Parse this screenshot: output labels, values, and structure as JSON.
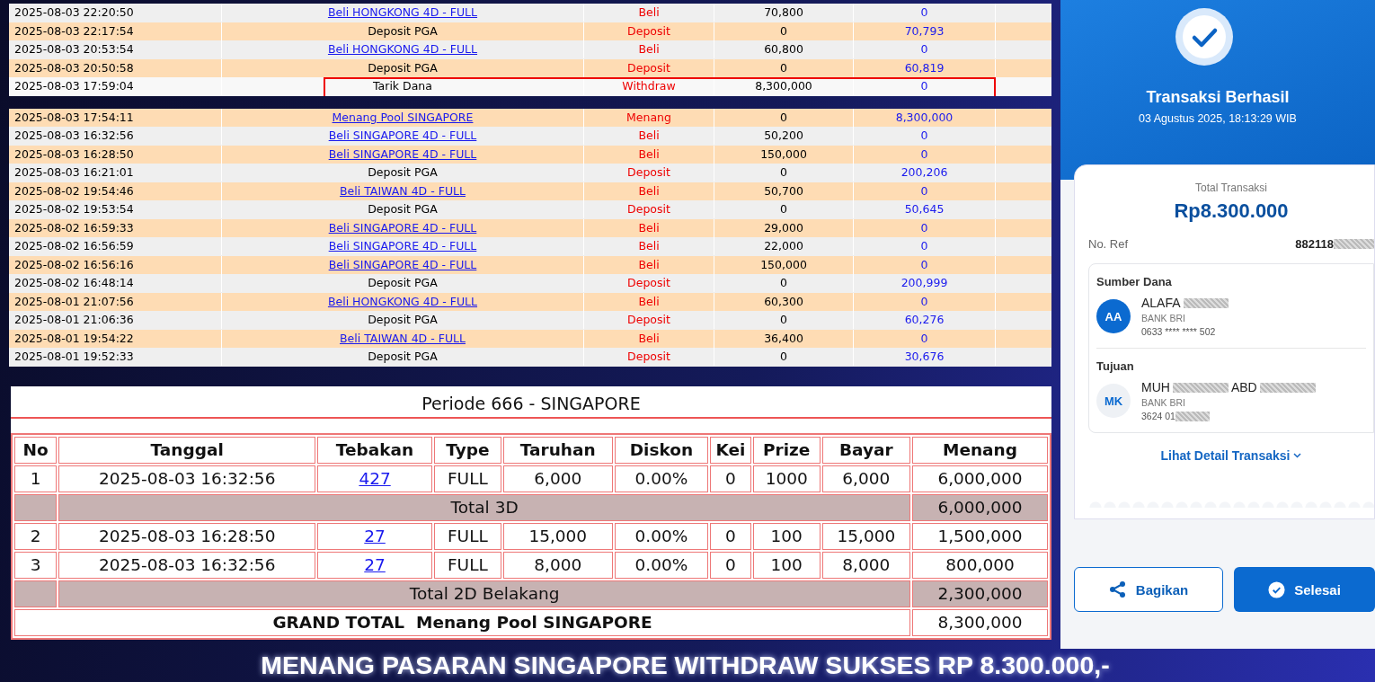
{
  "transactions_top": {
    "rows": [
      {
        "date": "2025-08-03 22:20:50",
        "description": "Beli HONGKONG 4D - FULL",
        "kind": "link",
        "type": "Beli",
        "amount": "70,800",
        "balance": "0",
        "highlighted": false
      },
      {
        "date": "2025-08-03 22:17:54",
        "description": "Deposit PGA",
        "kind": "text",
        "type": "Deposit",
        "amount": "0",
        "balance": "70,793",
        "highlighted": false
      },
      {
        "date": "2025-08-03 20:53:54",
        "description": "Beli HONGKONG 4D - FULL",
        "kind": "link",
        "type": "Beli",
        "amount": "60,800",
        "balance": "0",
        "highlighted": false
      },
      {
        "date": "2025-08-03 20:50:58",
        "description": "Deposit PGA",
        "kind": "text",
        "type": "Deposit",
        "amount": "0",
        "balance": "60,819",
        "highlighted": false
      },
      {
        "date": "2025-08-03 17:59:04",
        "description": "Tarik Dana",
        "kind": "text",
        "type": "Withdraw",
        "amount": "8,300,000",
        "balance": "0",
        "highlighted": true
      }
    ]
  },
  "transactions": {
    "rows": [
      {
        "date": "2025-08-03 17:54:11",
        "description": "Menang Pool SINGAPORE",
        "kind": "link",
        "type": "Menang",
        "amount": "0",
        "balance": "8,300,000",
        "highlighted": false
      },
      {
        "date": "2025-08-03 16:32:56",
        "description": "Beli SINGAPORE 4D - FULL",
        "kind": "link",
        "type": "Beli",
        "amount": "50,200",
        "balance": "0",
        "highlighted": false
      },
      {
        "date": "2025-08-03 16:28:50",
        "description": "Beli SINGAPORE 4D - FULL",
        "kind": "link",
        "type": "Beli",
        "amount": "150,000",
        "balance": "0",
        "highlighted": false
      },
      {
        "date": "2025-08-03 16:21:01",
        "description": "Deposit PGA",
        "kind": "text",
        "type": "Deposit",
        "amount": "0",
        "balance": "200,206",
        "highlighted": false
      },
      {
        "date": "2025-08-02 19:54:46",
        "description": "Beli TAIWAN 4D - FULL",
        "kind": "link",
        "type": "Beli",
        "amount": "50,700",
        "balance": "0",
        "highlighted": false
      },
      {
        "date": "2025-08-02 19:53:54",
        "description": "Deposit PGA",
        "kind": "text",
        "type": "Deposit",
        "amount": "0",
        "balance": "50,645",
        "highlighted": false
      },
      {
        "date": "2025-08-02 16:59:33",
        "description": "Beli SINGAPORE 4D - FULL",
        "kind": "link",
        "type": "Beli",
        "amount": "29,000",
        "balance": "0",
        "highlighted": false
      },
      {
        "date": "2025-08-02 16:56:59",
        "description": "Beli SINGAPORE 4D - FULL",
        "kind": "link",
        "type": "Beli",
        "amount": "22,000",
        "balance": "0",
        "highlighted": false
      },
      {
        "date": "2025-08-02 16:56:16",
        "description": "Beli SINGAPORE 4D - FULL",
        "kind": "link",
        "type": "Beli",
        "amount": "150,000",
        "balance": "0",
        "highlighted": false
      },
      {
        "date": "2025-08-02 16:48:14",
        "description": "Deposit PGA",
        "kind": "text",
        "type": "Deposit",
        "amount": "0",
        "balance": "200,999",
        "highlighted": false
      },
      {
        "date": "2025-08-01 21:07:56",
        "description": "Beli HONGKONG 4D - FULL",
        "kind": "link",
        "type": "Beli",
        "amount": "60,300",
        "balance": "0",
        "highlighted": false
      },
      {
        "date": "2025-08-01 21:06:36",
        "description": "Deposit PGA",
        "kind": "text",
        "type": "Deposit",
        "amount": "0",
        "balance": "60,276",
        "highlighted": false
      },
      {
        "date": "2025-08-01 19:54:22",
        "description": "Beli TAIWAN 4D - FULL",
        "kind": "link",
        "type": "Beli",
        "amount": "36,400",
        "balance": "0",
        "highlighted": false
      },
      {
        "date": "2025-08-01 19:52:33",
        "description": "Deposit PGA",
        "kind": "text",
        "type": "Deposit",
        "amount": "0",
        "balance": "30,676",
        "highlighted": false
      }
    ]
  },
  "bet_report": {
    "title": "Periode 666 - SINGAPORE",
    "columns": [
      "No",
      "Tanggal",
      "Tebakan",
      "Type",
      "Taruhan",
      "Diskon",
      "Kei",
      "Prize",
      "Bayar",
      "Menang"
    ],
    "rows": [
      {
        "kind": "bet",
        "cells": [
          "1",
          "2025-08-03 16:32:56",
          "427",
          "FULL",
          "6,000",
          "0.00%",
          "0",
          "1000",
          "6,000",
          "6,000,000"
        ]
      },
      {
        "kind": "subtotal",
        "label": "Total 3D",
        "win": "6,000,000"
      },
      {
        "kind": "bet",
        "cells": [
          "2",
          "2025-08-03 16:28:50",
          "27",
          "FULL",
          "15,000",
          "0.00%",
          "0",
          "100",
          "15,000",
          "1,500,000"
        ]
      },
      {
        "kind": "bet",
        "cells": [
          "3",
          "2025-08-03 16:32:56",
          "27",
          "FULL",
          "8,000",
          "0.00%",
          "0",
          "100",
          "8,000",
          "800,000"
        ]
      },
      {
        "kind": "subtotal",
        "label": "Total 2D Belakang",
        "win": "2,300,000"
      },
      {
        "kind": "grand",
        "label": "GRAND TOTAL  Menang Pool SINGAPORE",
        "win": "8,300,000"
      }
    ]
  },
  "receipt": {
    "title": "Transaksi Berhasil",
    "datetime": "03 Agustus 2025, 18:13:29 WIB",
    "total_label": "Total Transaksi",
    "total": "Rp8.300.000",
    "ref_label": "No. Ref",
    "ref": "882118",
    "parties": [
      {
        "label": "Sumber Dana",
        "initials": "AA",
        "kind": "filled",
        "name_parts": [
          "ALAFA"
        ],
        "bank": "BANK BRI",
        "account": "0633 **** **** 502",
        "account_redacted": false
      },
      {
        "label": "Tujuan",
        "initials": "MK",
        "kind": "light",
        "name_parts": [
          "MUH",
          "ABD"
        ],
        "bank": "BANK BRI",
        "account": "3624 01",
        "account_redacted": true
      }
    ],
    "detail_link": "Lihat Detail Transaksi",
    "buttons": [
      {
        "label": "Bagikan",
        "kind": "outline"
      },
      {
        "label": "Selesai",
        "kind": "primary"
      }
    ]
  },
  "banner": {
    "text": "MENANG PASARAN SINGAPORE WITHDRAW SUKSES RP 8.300.000,-"
  }
}
